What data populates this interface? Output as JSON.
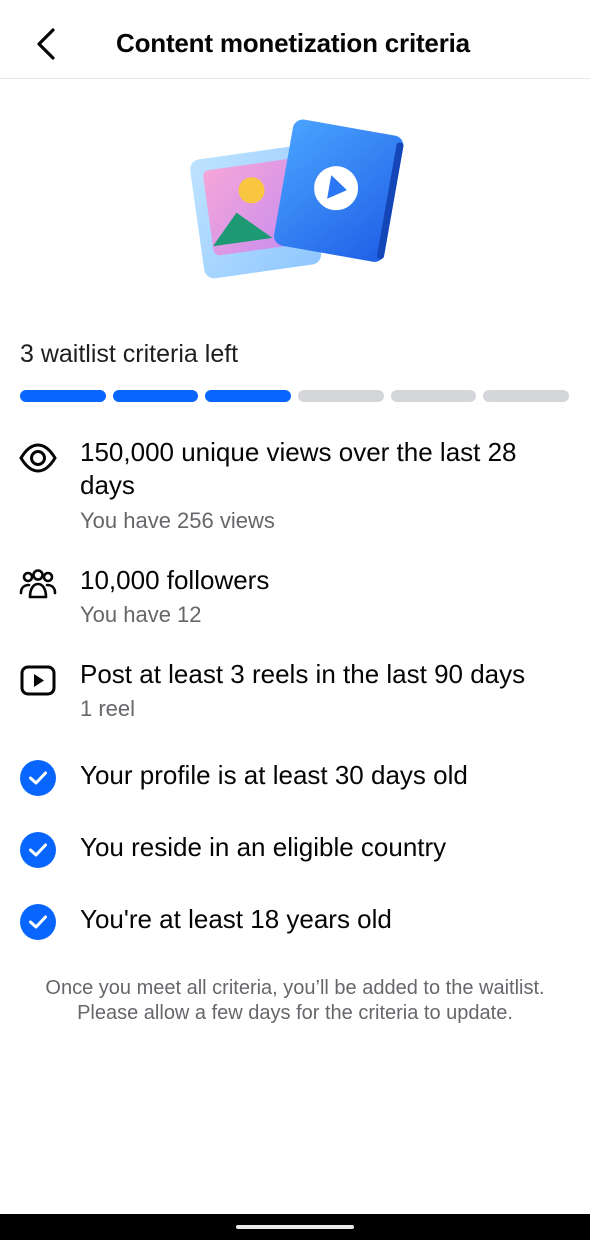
{
  "header": {
    "title": "Content monetization criteria"
  },
  "status": {
    "label": "3 waitlist criteria left",
    "segments_total": 6,
    "segments_completed": 3
  },
  "criteria": [
    {
      "icon": "eye-icon",
      "title": "150,000 unique views over the last 28 days",
      "subtitle": "You have 256 views",
      "met": false
    },
    {
      "icon": "people-icon",
      "title": "10,000 followers",
      "subtitle": "You have 12",
      "met": false
    },
    {
      "icon": "reels-icon",
      "title": "Post at least 3 reels in the last 90 days",
      "subtitle": "1 reel",
      "met": false
    },
    {
      "icon": "check-circle-icon",
      "title": "Your profile is at least 30 days old",
      "met": true
    },
    {
      "icon": "check-circle-icon",
      "title": "You reside in an eligible country",
      "met": true
    },
    {
      "icon": "check-circle-icon",
      "title": "You're at least 18 years old",
      "met": true
    }
  ],
  "footnote": {
    "line1": "Once you meet all criteria, you’ll be added to the waitlist.",
    "line2": "Please allow a few days for the criteria to update."
  },
  "colors": {
    "accent": "#0866ff",
    "progress_inactive": "#d4d6d9",
    "secondary_text": "#65676b"
  }
}
